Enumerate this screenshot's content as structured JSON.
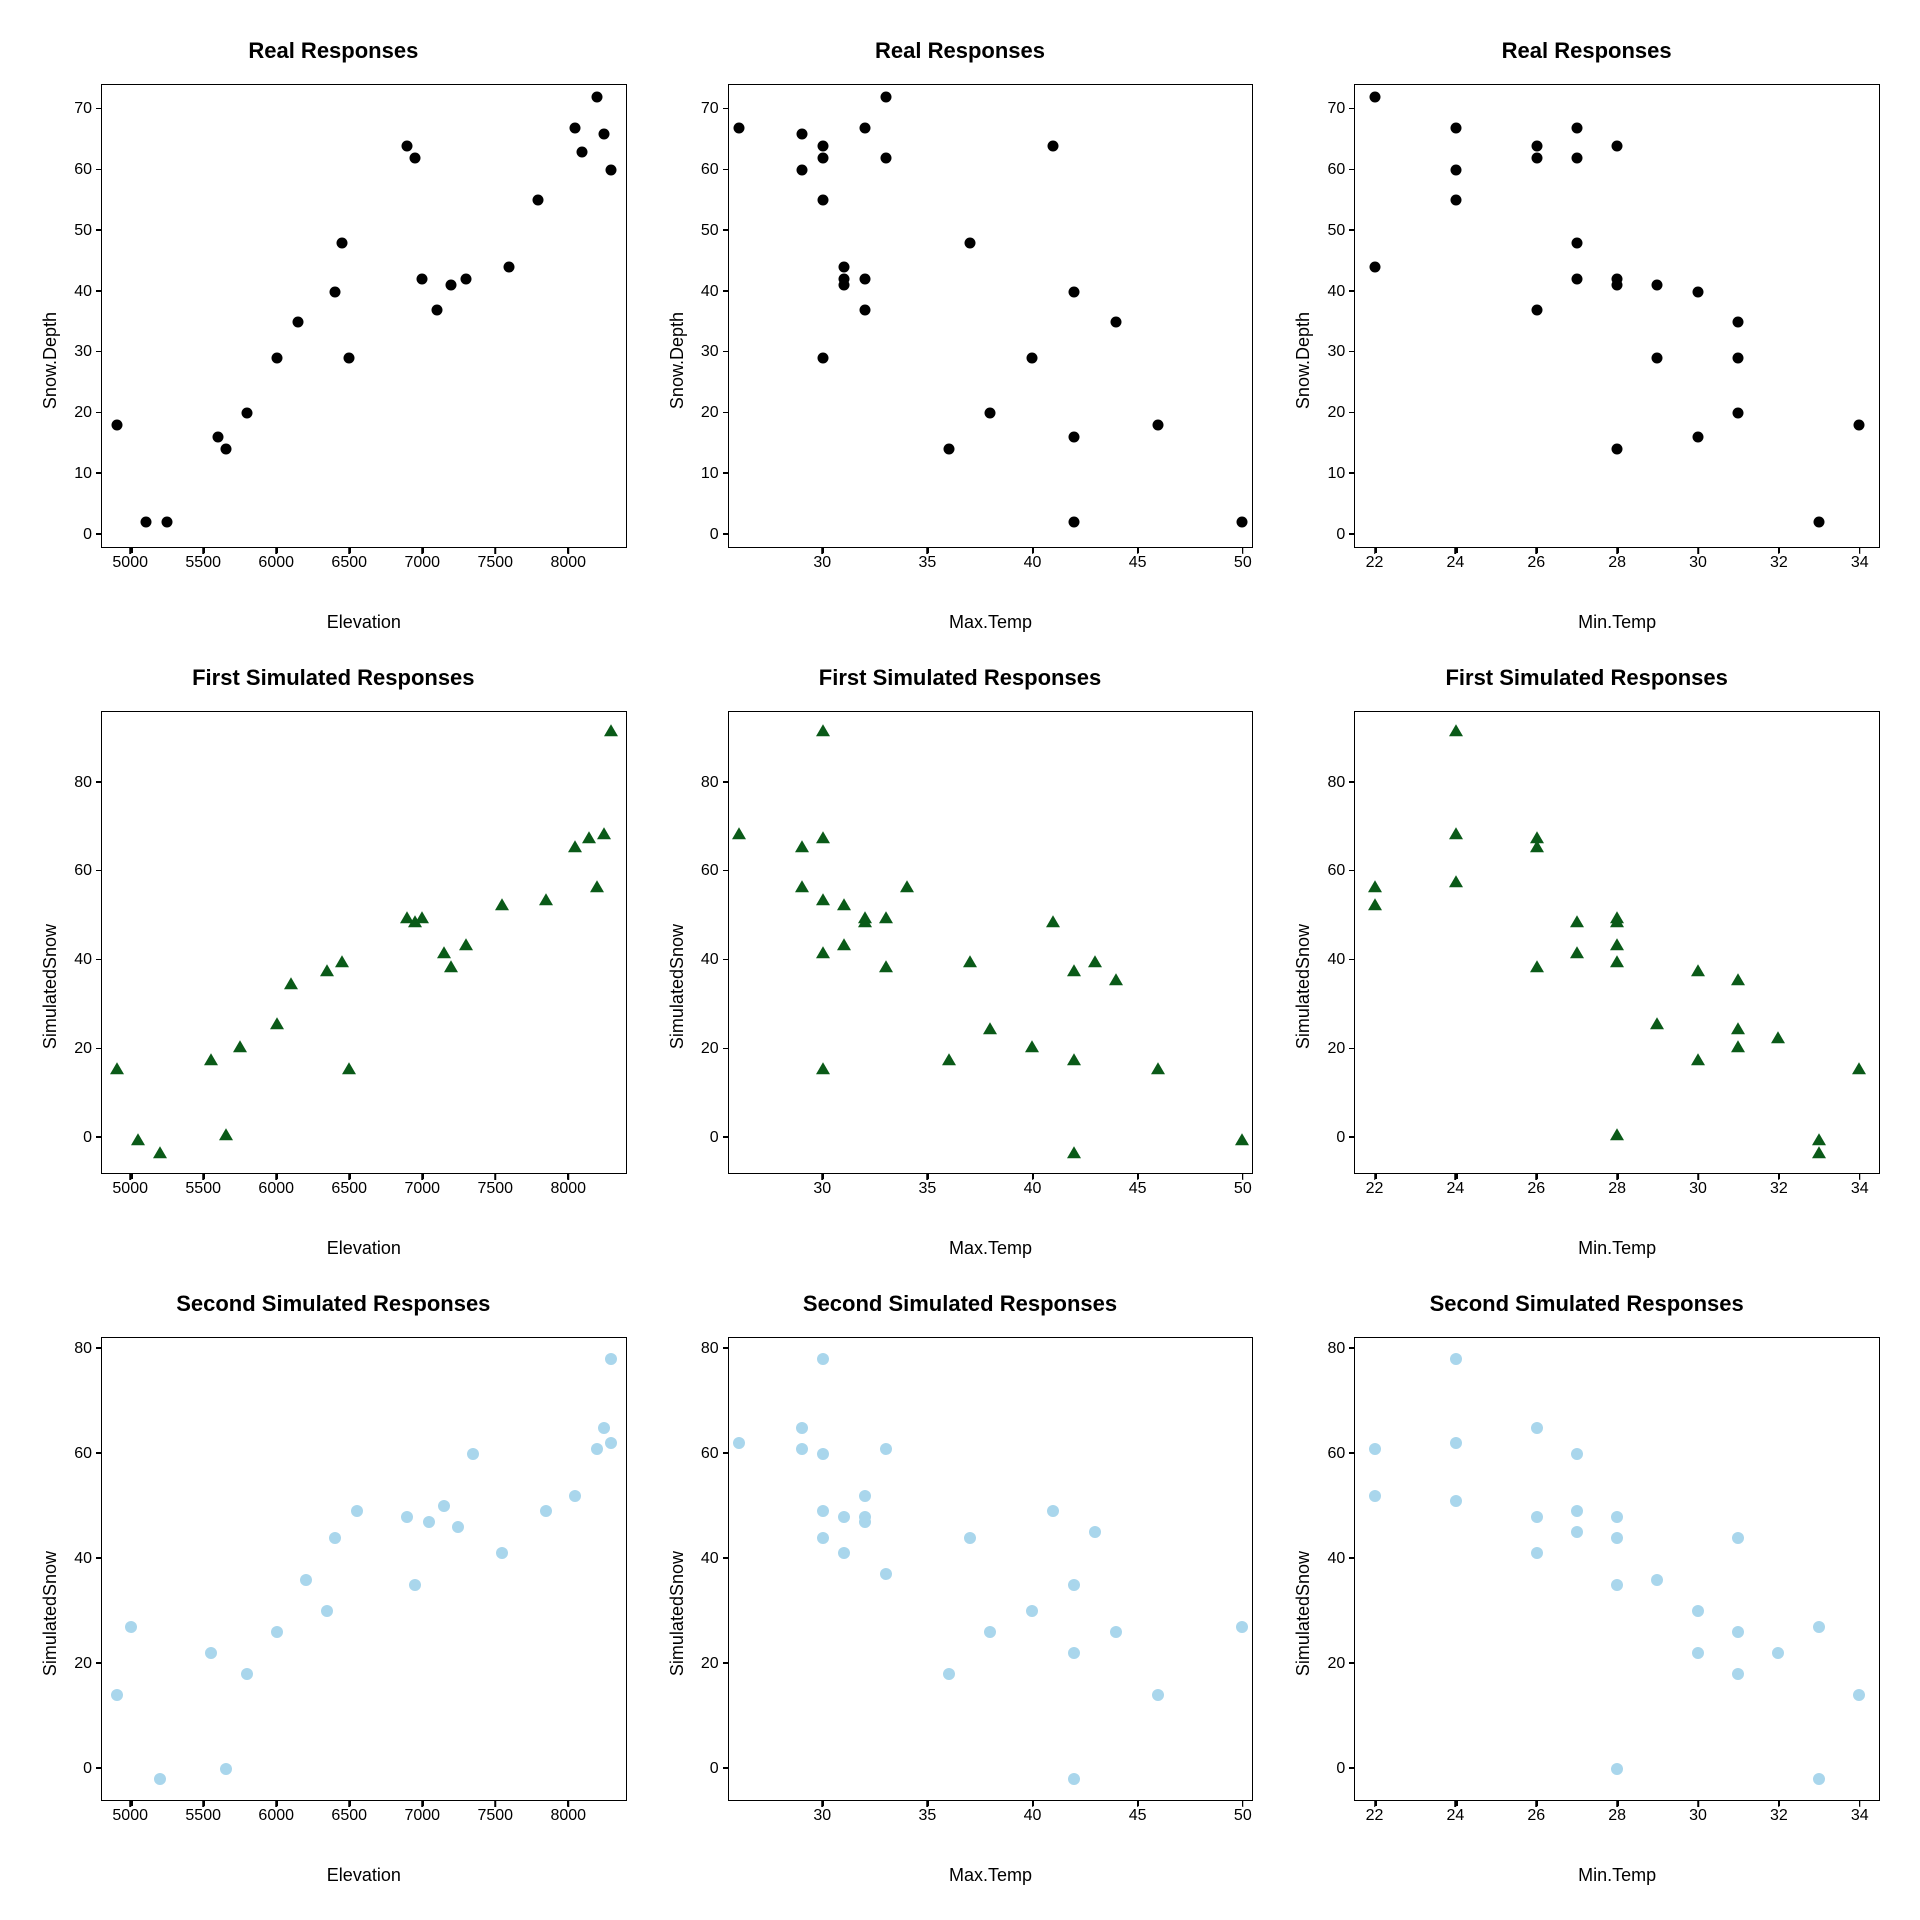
{
  "chart_data": [
    {
      "type": "scatter",
      "title": "Real Responses",
      "xlabel": "Elevation",
      "ylabel": "Snow.Depth",
      "marker": "circle-black",
      "xlim": [
        4800,
        8400
      ],
      "ylim": [
        -2,
        74
      ],
      "xticks": [
        5000,
        5500,
        6000,
        6500,
        7000,
        7500,
        8000
      ],
      "yticks": [
        0,
        10,
        20,
        30,
        40,
        50,
        60,
        70
      ],
      "points": [
        {
          "x": 4900,
          "y": 18
        },
        {
          "x": 5100,
          "y": 2
        },
        {
          "x": 5250,
          "y": 2
        },
        {
          "x": 5600,
          "y": 16
        },
        {
          "x": 5650,
          "y": 14
        },
        {
          "x": 5800,
          "y": 20
        },
        {
          "x": 6000,
          "y": 29
        },
        {
          "x": 6150,
          "y": 35
        },
        {
          "x": 6400,
          "y": 40
        },
        {
          "x": 6500,
          "y": 29
        },
        {
          "x": 6450,
          "y": 48
        },
        {
          "x": 6900,
          "y": 64
        },
        {
          "x": 6950,
          "y": 62
        },
        {
          "x": 7000,
          "y": 42
        },
        {
          "x": 7100,
          "y": 37
        },
        {
          "x": 7200,
          "y": 41
        },
        {
          "x": 7300,
          "y": 42
        },
        {
          "x": 7600,
          "y": 44
        },
        {
          "x": 7800,
          "y": 55
        },
        {
          "x": 8050,
          "y": 67
        },
        {
          "x": 8100,
          "y": 63
        },
        {
          "x": 8200,
          "y": 72
        },
        {
          "x": 8250,
          "y": 66
        },
        {
          "x": 8300,
          "y": 60
        }
      ]
    },
    {
      "type": "scatter",
      "title": "Real Responses",
      "xlabel": "Max.Temp",
      "ylabel": "Snow.Depth",
      "marker": "circle-black",
      "xlim": [
        25.5,
        50.5
      ],
      "ylim": [
        -2,
        74
      ],
      "xticks": [
        30,
        35,
        40,
        45,
        50
      ],
      "yticks": [
        0,
        10,
        20,
        30,
        40,
        50,
        60,
        70
      ],
      "points": [
        {
          "x": 26,
          "y": 67
        },
        {
          "x": 29,
          "y": 60
        },
        {
          "x": 29,
          "y": 66
        },
        {
          "x": 30,
          "y": 55
        },
        {
          "x": 30,
          "y": 62
        },
        {
          "x": 30,
          "y": 64
        },
        {
          "x": 30,
          "y": 29
        },
        {
          "x": 31,
          "y": 41
        },
        {
          "x": 31,
          "y": 42
        },
        {
          "x": 31,
          "y": 44
        },
        {
          "x": 32,
          "y": 67
        },
        {
          "x": 32,
          "y": 42
        },
        {
          "x": 32,
          "y": 37
        },
        {
          "x": 33,
          "y": 72
        },
        {
          "x": 33,
          "y": 62
        },
        {
          "x": 36,
          "y": 14
        },
        {
          "x": 37,
          "y": 48
        },
        {
          "x": 38,
          "y": 20
        },
        {
          "x": 40,
          "y": 29
        },
        {
          "x": 41,
          "y": 64
        },
        {
          "x": 42,
          "y": 2
        },
        {
          "x": 42,
          "y": 16
        },
        {
          "x": 42,
          "y": 40
        },
        {
          "x": 44,
          "y": 35
        },
        {
          "x": 46,
          "y": 18
        },
        {
          "x": 50,
          "y": 2
        }
      ]
    },
    {
      "type": "scatter",
      "title": "Real Responses",
      "xlabel": "Min.Temp",
      "ylabel": "Snow.Depth",
      "marker": "circle-black",
      "xlim": [
        21.5,
        34.5
      ],
      "ylim": [
        -2,
        74
      ],
      "xticks": [
        22,
        24,
        26,
        28,
        30,
        32,
        34
      ],
      "yticks": [
        0,
        10,
        20,
        30,
        40,
        50,
        60,
        70
      ],
      "points": [
        {
          "x": 22,
          "y": 72
        },
        {
          "x": 22,
          "y": 44
        },
        {
          "x": 24,
          "y": 67
        },
        {
          "x": 24,
          "y": 60
        },
        {
          "x": 24,
          "y": 55
        },
        {
          "x": 26,
          "y": 62
        },
        {
          "x": 26,
          "y": 64
        },
        {
          "x": 26,
          "y": 37
        },
        {
          "x": 27,
          "y": 67
        },
        {
          "x": 27,
          "y": 62
        },
        {
          "x": 27,
          "y": 48
        },
        {
          "x": 27,
          "y": 42
        },
        {
          "x": 28,
          "y": 64
        },
        {
          "x": 28,
          "y": 41
        },
        {
          "x": 28,
          "y": 42
        },
        {
          "x": 28,
          "y": 14
        },
        {
          "x": 29,
          "y": 41
        },
        {
          "x": 29,
          "y": 29
        },
        {
          "x": 30,
          "y": 40
        },
        {
          "x": 30,
          "y": 16
        },
        {
          "x": 31,
          "y": 35
        },
        {
          "x": 31,
          "y": 29
        },
        {
          "x": 31,
          "y": 20
        },
        {
          "x": 33,
          "y": 2
        },
        {
          "x": 34,
          "y": 18
        }
      ]
    },
    {
      "type": "scatter",
      "title": "First Simulated Responses",
      "xlabel": "Elevation",
      "ylabel": "SimulatedSnow",
      "marker": "triangle-green",
      "xlim": [
        4800,
        8400
      ],
      "ylim": [
        -8,
        96
      ],
      "xticks": [
        5000,
        5500,
        6000,
        6500,
        7000,
        7500,
        8000
      ],
      "yticks": [
        0,
        20,
        40,
        60,
        80
      ],
      "points": [
        {
          "x": 4900,
          "y": 16
        },
        {
          "x": 5050,
          "y": 0
        },
        {
          "x": 5200,
          "y": -3
        },
        {
          "x": 5550,
          "y": 18
        },
        {
          "x": 5650,
          "y": 1
        },
        {
          "x": 5750,
          "y": 21
        },
        {
          "x": 6000,
          "y": 26
        },
        {
          "x": 6100,
          "y": 35
        },
        {
          "x": 6350,
          "y": 38
        },
        {
          "x": 6450,
          "y": 40
        },
        {
          "x": 6500,
          "y": 16
        },
        {
          "x": 6900,
          "y": 50
        },
        {
          "x": 6950,
          "y": 49
        },
        {
          "x": 7000,
          "y": 50
        },
        {
          "x": 7150,
          "y": 42
        },
        {
          "x": 7200,
          "y": 39
        },
        {
          "x": 7300,
          "y": 44
        },
        {
          "x": 7550,
          "y": 53
        },
        {
          "x": 7850,
          "y": 54
        },
        {
          "x": 8050,
          "y": 66
        },
        {
          "x": 8150,
          "y": 68
        },
        {
          "x": 8200,
          "y": 57
        },
        {
          "x": 8250,
          "y": 69
        },
        {
          "x": 8300,
          "y": 92
        }
      ]
    },
    {
      "type": "scatter",
      "title": "First Simulated Responses",
      "xlabel": "Max.Temp",
      "ylabel": "SimulatedSnow",
      "marker": "triangle-green",
      "xlim": [
        25.5,
        50.5
      ],
      "ylim": [
        -8,
        96
      ],
      "xticks": [
        30,
        35,
        40,
        45,
        50
      ],
      "yticks": [
        0,
        20,
        40,
        60,
        80
      ],
      "points": [
        {
          "x": 26,
          "y": 69
        },
        {
          "x": 29,
          "y": 57
        },
        {
          "x": 29,
          "y": 66
        },
        {
          "x": 30,
          "y": 92
        },
        {
          "x": 30,
          "y": 68
        },
        {
          "x": 30,
          "y": 54
        },
        {
          "x": 30,
          "y": 42
        },
        {
          "x": 30,
          "y": 16
        },
        {
          "x": 31,
          "y": 53
        },
        {
          "x": 31,
          "y": 44
        },
        {
          "x": 32,
          "y": 49
        },
        {
          "x": 32,
          "y": 50
        },
        {
          "x": 33,
          "y": 50
        },
        {
          "x": 33,
          "y": 39
        },
        {
          "x": 34,
          "y": 57
        },
        {
          "x": 36,
          "y": 18
        },
        {
          "x": 37,
          "y": 40
        },
        {
          "x": 38,
          "y": 25
        },
        {
          "x": 40,
          "y": 21
        },
        {
          "x": 41,
          "y": 49
        },
        {
          "x": 42,
          "y": 18
        },
        {
          "x": 42,
          "y": 38
        },
        {
          "x": 42,
          "y": -3
        },
        {
          "x": 43,
          "y": 40
        },
        {
          "x": 44,
          "y": 36
        },
        {
          "x": 46,
          "y": 16
        },
        {
          "x": 50,
          "y": 0
        }
      ]
    },
    {
      "type": "scatter",
      "title": "First Simulated Responses",
      "xlabel": "Min.Temp",
      "ylabel": "SimulatedSnow",
      "marker": "triangle-green",
      "xlim": [
        21.5,
        34.5
      ],
      "ylim": [
        -8,
        96
      ],
      "xticks": [
        22,
        24,
        26,
        28,
        30,
        32,
        34
      ],
      "yticks": [
        0,
        20,
        40,
        60,
        80
      ],
      "points": [
        {
          "x": 22,
          "y": 57
        },
        {
          "x": 22,
          "y": 53
        },
        {
          "x": 24,
          "y": 92
        },
        {
          "x": 24,
          "y": 69
        },
        {
          "x": 24,
          "y": 58
        },
        {
          "x": 26,
          "y": 68
        },
        {
          "x": 26,
          "y": 66
        },
        {
          "x": 26,
          "y": 39
        },
        {
          "x": 27,
          "y": 49
        },
        {
          "x": 27,
          "y": 42
        },
        {
          "x": 28,
          "y": 50
        },
        {
          "x": 28,
          "y": 49
        },
        {
          "x": 28,
          "y": 40
        },
        {
          "x": 28,
          "y": 44
        },
        {
          "x": 28,
          "y": 1
        },
        {
          "x": 29,
          "y": 26
        },
        {
          "x": 30,
          "y": 38
        },
        {
          "x": 30,
          "y": 18
        },
        {
          "x": 31,
          "y": 36
        },
        {
          "x": 31,
          "y": 25
        },
        {
          "x": 31,
          "y": 21
        },
        {
          "x": 32,
          "y": 23
        },
        {
          "x": 33,
          "y": -3
        },
        {
          "x": 33,
          "y": 0
        },
        {
          "x": 34,
          "y": 16
        }
      ]
    },
    {
      "type": "scatter",
      "title": "Second Simulated Responses",
      "xlabel": "Elevation",
      "ylabel": "SimulatedSnow",
      "marker": "circle-blue",
      "xlim": [
        4800,
        8400
      ],
      "ylim": [
        -6,
        82
      ],
      "xticks": [
        5000,
        5500,
        6000,
        6500,
        7000,
        7500,
        8000
      ],
      "yticks": [
        0,
        20,
        40,
        60,
        80
      ],
      "points": [
        {
          "x": 4900,
          "y": 14
        },
        {
          "x": 5000,
          "y": 27
        },
        {
          "x": 5200,
          "y": -2
        },
        {
          "x": 5550,
          "y": 22
        },
        {
          "x": 5650,
          "y": 0
        },
        {
          "x": 5800,
          "y": 18
        },
        {
          "x": 6000,
          "y": 26
        },
        {
          "x": 6200,
          "y": 36
        },
        {
          "x": 6350,
          "y": 30
        },
        {
          "x": 6400,
          "y": 44
        },
        {
          "x": 6550,
          "y": 49
        },
        {
          "x": 6900,
          "y": 48
        },
        {
          "x": 6950,
          "y": 35
        },
        {
          "x": 7050,
          "y": 47
        },
        {
          "x": 7150,
          "y": 50
        },
        {
          "x": 7250,
          "y": 46
        },
        {
          "x": 7350,
          "y": 60
        },
        {
          "x": 7550,
          "y": 41
        },
        {
          "x": 7850,
          "y": 49
        },
        {
          "x": 8050,
          "y": 52
        },
        {
          "x": 8200,
          "y": 61
        },
        {
          "x": 8250,
          "y": 65
        },
        {
          "x": 8300,
          "y": 62
        },
        {
          "x": 8300,
          "y": 78
        }
      ]
    },
    {
      "type": "scatter",
      "title": "Second Simulated Responses",
      "xlabel": "Max.Temp",
      "ylabel": "SimulatedSnow",
      "marker": "circle-blue",
      "xlim": [
        25.5,
        50.5
      ],
      "ylim": [
        -6,
        82
      ],
      "xticks": [
        30,
        35,
        40,
        45,
        50
      ],
      "yticks": [
        0,
        20,
        40,
        60,
        80
      ],
      "points": [
        {
          "x": 26,
          "y": 62
        },
        {
          "x": 29,
          "y": 61
        },
        {
          "x": 29,
          "y": 65
        },
        {
          "x": 30,
          "y": 78
        },
        {
          "x": 30,
          "y": 60
        },
        {
          "x": 30,
          "y": 49
        },
        {
          "x": 30,
          "y": 44
        },
        {
          "x": 31,
          "y": 41
        },
        {
          "x": 31,
          "y": 48
        },
        {
          "x": 32,
          "y": 52
        },
        {
          "x": 32,
          "y": 47
        },
        {
          "x": 32,
          "y": 48
        },
        {
          "x": 33,
          "y": 61
        },
        {
          "x": 33,
          "y": 37
        },
        {
          "x": 36,
          "y": 18
        },
        {
          "x": 37,
          "y": 44
        },
        {
          "x": 38,
          "y": 26
        },
        {
          "x": 40,
          "y": 30
        },
        {
          "x": 41,
          "y": 49
        },
        {
          "x": 42,
          "y": 35
        },
        {
          "x": 42,
          "y": -2
        },
        {
          "x": 42,
          "y": 22
        },
        {
          "x": 43,
          "y": 45
        },
        {
          "x": 44,
          "y": 26
        },
        {
          "x": 46,
          "y": 14
        },
        {
          "x": 50,
          "y": 27
        }
      ]
    },
    {
      "type": "scatter",
      "title": "Second Simulated Responses",
      "xlabel": "Min.Temp",
      "ylabel": "SimulatedSnow",
      "marker": "circle-blue",
      "xlim": [
        21.5,
        34.5
      ],
      "ylim": [
        -6,
        82
      ],
      "xticks": [
        22,
        24,
        26,
        28,
        30,
        32,
        34
      ],
      "yticks": [
        0,
        20,
        40,
        60,
        80
      ],
      "points": [
        {
          "x": 22,
          "y": 61
        },
        {
          "x": 22,
          "y": 52
        },
        {
          "x": 24,
          "y": 78
        },
        {
          "x": 24,
          "y": 62
        },
        {
          "x": 24,
          "y": 51
        },
        {
          "x": 26,
          "y": 65
        },
        {
          "x": 26,
          "y": 48
        },
        {
          "x": 26,
          "y": 41
        },
        {
          "x": 27,
          "y": 49
        },
        {
          "x": 27,
          "y": 60
        },
        {
          "x": 27,
          "y": 45
        },
        {
          "x": 28,
          "y": 48
        },
        {
          "x": 28,
          "y": 44
        },
        {
          "x": 28,
          "y": 35
        },
        {
          "x": 28,
          "y": 0
        },
        {
          "x": 29,
          "y": 36
        },
        {
          "x": 30,
          "y": 30
        },
        {
          "x": 30,
          "y": 22
        },
        {
          "x": 31,
          "y": 44
        },
        {
          "x": 31,
          "y": 26
        },
        {
          "x": 31,
          "y": 18
        },
        {
          "x": 32,
          "y": 22
        },
        {
          "x": 33,
          "y": 27
        },
        {
          "x": 33,
          "y": -2
        },
        {
          "x": 34,
          "y": 14
        }
      ]
    }
  ]
}
